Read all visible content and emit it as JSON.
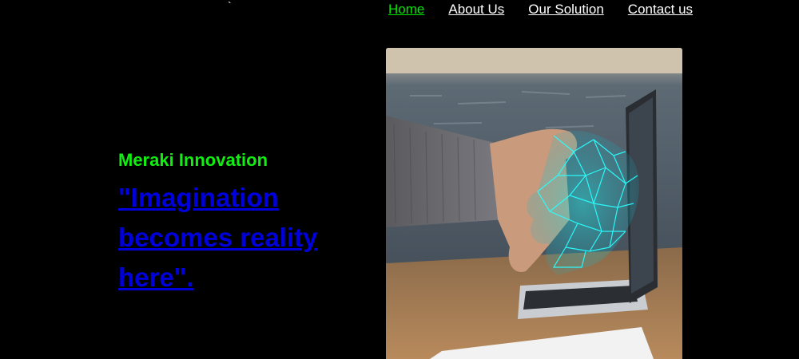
{
  "header": {
    "logo_mark": "`"
  },
  "nav": {
    "items": [
      {
        "label": "Home",
        "active": true
      },
      {
        "label": "About Us",
        "active": false
      },
      {
        "label": "Our Solution",
        "active": false
      },
      {
        "label": "Contact us",
        "active": false
      }
    ]
  },
  "hero": {
    "subtitle": "Meraki Innovation",
    "headline": "\"Imagination becomes reality here\"."
  },
  "colors": {
    "background": "#000000",
    "nav_active": "#00e600",
    "nav_default": "#ffffff",
    "subtitle": "#11ee11",
    "headline_link": "#0000dd"
  },
  "image": {
    "icon": "handshake-laptop-illustration"
  }
}
